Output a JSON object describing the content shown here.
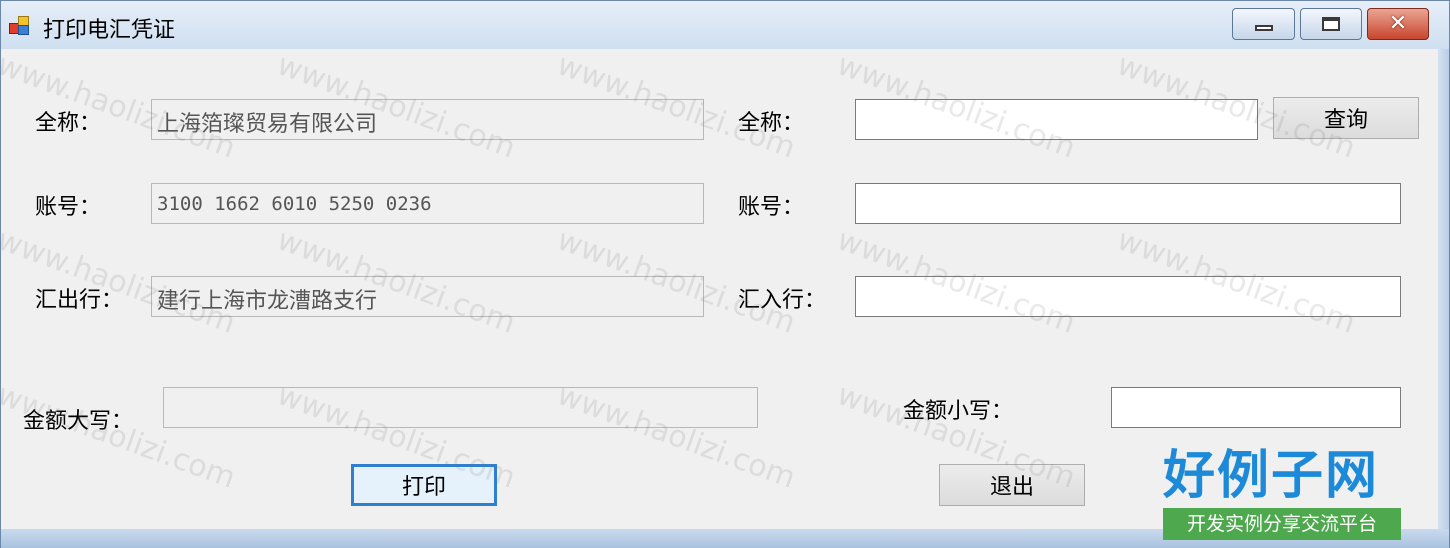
{
  "window": {
    "title": "打印电汇凭证"
  },
  "left": {
    "name_label": "全称：",
    "name_value": "上海箔璨贸易有限公司",
    "account_label": "账号：",
    "account_value": "3100 1662 6010 5250 0236",
    "bank_label": "汇出行：",
    "bank_value": "建行上海市龙漕路支行",
    "amount_upper_label": "金额大写：",
    "amount_upper_value": ""
  },
  "right": {
    "name_label": "全称：",
    "name_value": "",
    "query_button": "查询",
    "account_label": "账号：",
    "account_value": "",
    "bank_label": "汇入行：",
    "bank_value": "",
    "amount_lower_label": "金额小写：",
    "amount_lower_value": ""
  },
  "buttons": {
    "print": "打印",
    "exit": "退出"
  },
  "watermark": {
    "text": "www.haolizi.com"
  },
  "logo": {
    "main": "好例子网",
    "sub": "开发实例分享交流平台"
  },
  "colors": {
    "accent": "#2f7fd0",
    "logo_blue": "#1c8ad8",
    "logo_green": "#4ea84d"
  }
}
